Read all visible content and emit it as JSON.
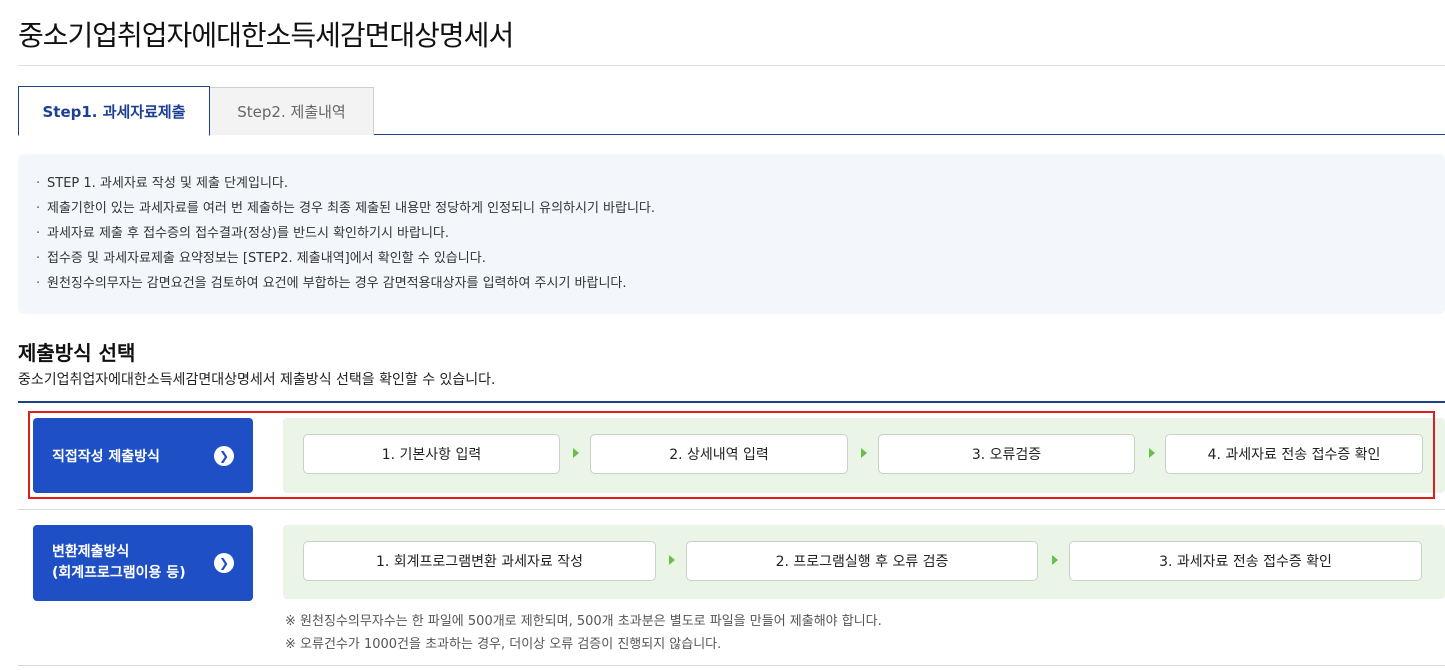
{
  "page": {
    "title": "중소기업취업자에대한소득세감면대상명세서"
  },
  "tabs": [
    {
      "label": "Step1. 과세자료제출",
      "active": true
    },
    {
      "label": "Step2. 제출내역",
      "active": false
    }
  ],
  "notice": {
    "items": [
      "STEP 1. 과세자료 작성 및 제출 단계입니다.",
      "제출기한이 있는 과세자료를 여러 번 제출하는 경우 최종 제출된 내용만 정당하게 인정되니 유의하시기 바랍니다.",
      "과세자료 제출 후 접수증의 접수결과(정상)를 반드시 확인하기시 바랍니다.",
      "접수증 및 과세자료제출 요약정보는 [STEP2. 제출내역]에서 확인할 수 있습니다.",
      "원천징수의무자는 감면요건을 검토하여 요건에 부합하는 경우 감면적용대상자를 입력하여 주시기 바랍니다."
    ]
  },
  "section": {
    "title": "제출방식 선택",
    "description": "중소기업취업자에대한소득세감면대상명세서 제출방식 선택을 확인할 수 있습니다."
  },
  "methods": [
    {
      "label_lines": [
        "직접작성 제출방식"
      ],
      "steps": [
        "1. 기본사항 입력",
        "2. 상세내역 입력",
        "3. 오류검증",
        "4. 과세자료 전송 접수증 확인"
      ]
    },
    {
      "label_lines": [
        "변환제출방식",
        "(회계프로그램이용 등)"
      ],
      "steps": [
        "1. 회계프로그램변환 과세자료 작성",
        "2. 프로그램실행 후 오류 검증",
        "3. 과세자료 전송 접수증 확인"
      ]
    }
  ],
  "notes": [
    "※ 원천징수의무자수는 한 파일에 500개로 제한되며, 500개 초과분은 별도로 파일을 만들어 제출해야 합니다.",
    "※ 오류건수가 1000건을 초과하는 경우, 더이상 오류 검증이 진행되지 않습니다."
  ],
  "colors": {
    "primary": "#1e4fc4",
    "tab_active_text": "#1d3f93",
    "steps_bg": "#eaf5e8",
    "step_arrow": "#6abf4b",
    "highlight": "#e01e1e"
  },
  "icons": {
    "method_arrow": "chevron-right-circle-icon",
    "step_arrow": "triangle-right-icon"
  }
}
